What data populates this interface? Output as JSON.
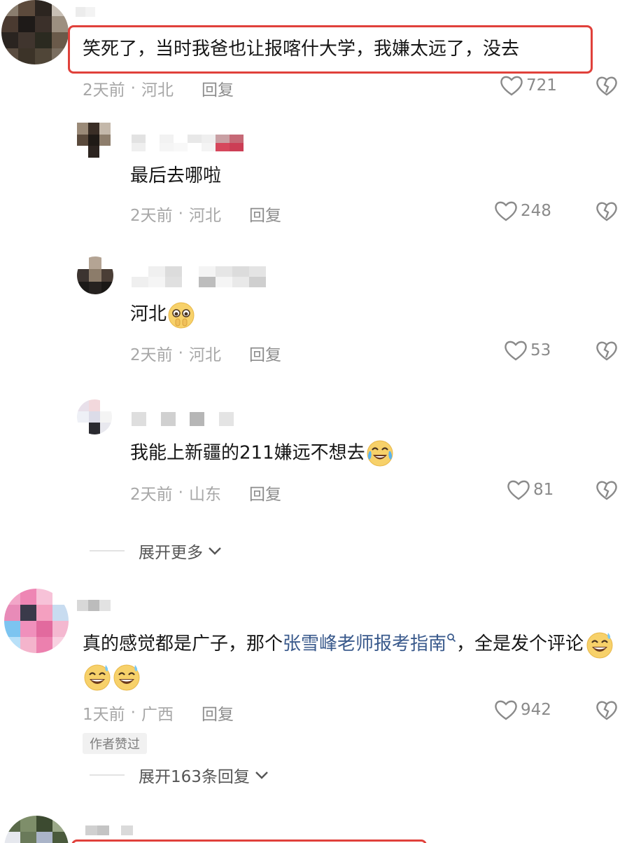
{
  "comments": [
    {
      "text": "笑死了，当时我爸也让报喀什大学，我嫌太远了，没去",
      "time": "2天前",
      "location": "河北",
      "reply_label": "回复",
      "likes": "721"
    },
    {
      "text": "最后去哪啦",
      "time": "2天前",
      "location": "河北",
      "reply_label": "回复",
      "likes": "248"
    },
    {
      "text": "河北",
      "time": "2天前",
      "location": "河北",
      "reply_label": "回复",
      "likes": "53"
    },
    {
      "text": "我能上新疆的211嫌远不想去",
      "time": "2天前",
      "location": "山东",
      "reply_label": "回复",
      "likes": "81"
    },
    {
      "text_before": "真的感觉都是广子，那个",
      "link": "张雪峰老师报考指南",
      "text_after": "，全是发个评论",
      "time": "1天前",
      "location": "广西",
      "reply_label": "回复",
      "likes": "942",
      "badge": "作者赞过"
    }
  ],
  "expand_more": "展开更多",
  "expand_replies": "展开163条回复",
  "separator": "·",
  "colors": {
    "highlight": "#e0413b",
    "link": "#3a5a8c"
  },
  "icons": [
    "heart-icon",
    "dislike-icon",
    "chevron-down-icon",
    "search-icon",
    "emoji-pleading",
    "emoji-tears-of-joy",
    "emoji-sweat-smile"
  ]
}
